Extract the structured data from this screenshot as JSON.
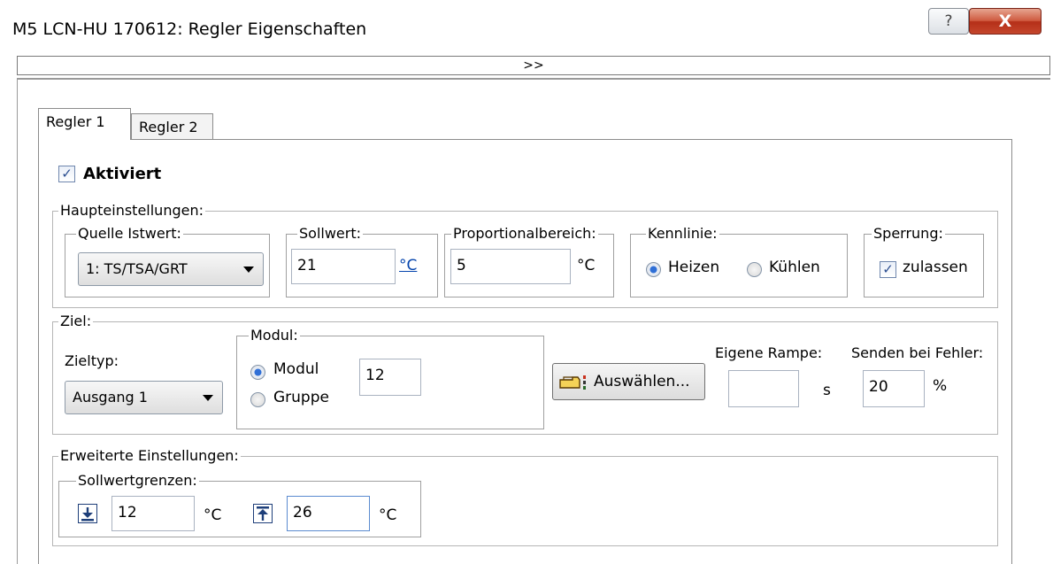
{
  "window": {
    "title": "M5 LCN-HU 170612: Regler Eigenschaften",
    "help_label": "?",
    "close_label": "X"
  },
  "expand_bar": {
    "label": ">>"
  },
  "tabs": [
    {
      "label": "Regler 1",
      "selected": true
    },
    {
      "label": "Regler 2",
      "selected": false
    }
  ],
  "aktiviert": {
    "label": "Aktiviert",
    "checked": true
  },
  "haupt": {
    "title": "Haupteinstellungen:",
    "quelle": {
      "title": "Quelle Istwert:",
      "value": "1: TS/TSA/GRT"
    },
    "sollwert": {
      "title": "Sollwert:",
      "value": "21",
      "unit": "°C"
    },
    "proportional": {
      "title": "Proportionalbereich:",
      "value": "5",
      "unit": "°C"
    },
    "kennlinie": {
      "title": "Kennlinie:",
      "options": [
        "Heizen",
        "Kühlen"
      ],
      "selected": "Heizen"
    },
    "sperrung": {
      "title": "Sperrung:",
      "checkbox_label": "zulassen",
      "checked": true
    }
  },
  "ziel": {
    "title": "Ziel:",
    "zieltyp_label": "Zieltyp:",
    "zieltyp_value": "Ausgang 1",
    "modul_group": {
      "title": "Modul:",
      "options": [
        "Modul",
        "Gruppe"
      ],
      "selected": "Modul",
      "value": "12"
    },
    "auswaehlen_label": "Auswählen...",
    "rampe": {
      "label": "Eigene Rampe:",
      "value": "",
      "unit": "s"
    },
    "senden": {
      "label": "Senden bei Fehler:",
      "value": "20",
      "unit": "%"
    }
  },
  "erweitert": {
    "title": "Erweiterte Einstellungen:",
    "sollwertgrenzen": {
      "title": "Sollwertgrenzen:",
      "min_value": "12",
      "min_unit": "°C",
      "max_value": "26",
      "max_unit": "°C"
    }
  },
  "colors": {
    "link_blue": "#0645ad",
    "check_blue": "#2a4d8f",
    "close_red": "#c4462c"
  }
}
